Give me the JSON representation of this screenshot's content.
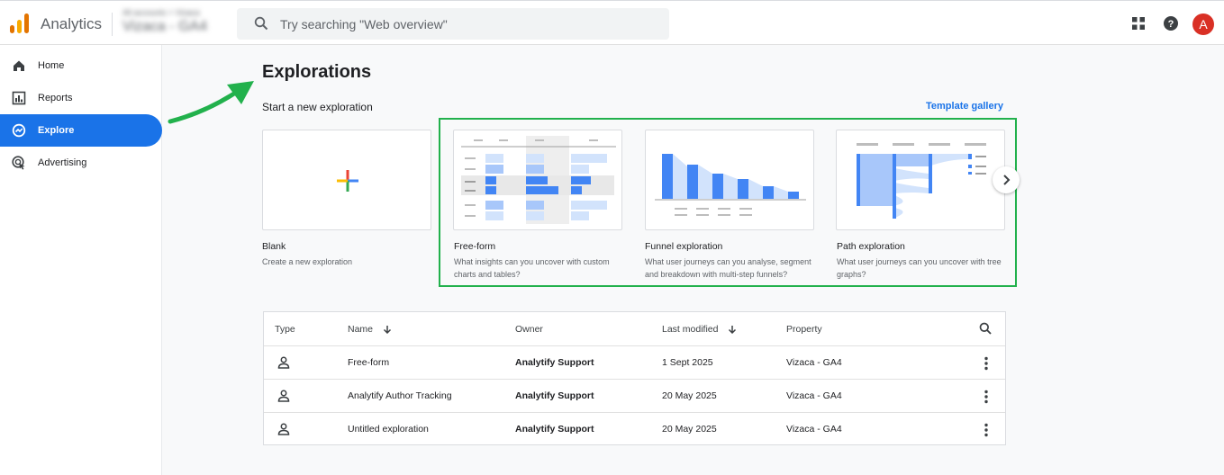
{
  "header": {
    "app_name": "Analytics",
    "account_crumb": "All accounts > Vizaca",
    "property_name": "Vizaca - GA4",
    "search_placeholder": "Try searching \"Web overview\"",
    "avatar_letter": "A",
    "icons": [
      "apps-grid-icon",
      "help-icon"
    ]
  },
  "sidebar": {
    "items": [
      {
        "label": "Home",
        "icon": "home-icon",
        "active": false
      },
      {
        "label": "Reports",
        "icon": "reports-icon",
        "active": false
      },
      {
        "label": "Explore",
        "icon": "explore-icon",
        "active": true
      },
      {
        "label": "Advertising",
        "icon": "advertising-icon",
        "active": false
      }
    ]
  },
  "main": {
    "title": "Explorations",
    "section_title": "Start a new exploration",
    "template_link": "Template gallery",
    "templates": [
      {
        "title": "Blank",
        "desc": "Create a new exploration"
      },
      {
        "title": "Free-form",
        "desc": "What insights can you uncover with custom charts and tables?"
      },
      {
        "title": "Funnel exploration",
        "desc": "What user journeys can you analyse, segment and breakdown with multi-step funnels?"
      },
      {
        "title": "Path exploration",
        "desc": "What user journeys can you uncover with tree graphs?"
      }
    ]
  },
  "table": {
    "headers": {
      "type": "Type",
      "name": "Name",
      "owner": "Owner",
      "last_modified": "Last modified",
      "property": "Property"
    },
    "rows": [
      {
        "name": "Free-form",
        "owner": "Analytify Support",
        "modified": "1 Sept 2025",
        "property": "Vizaca - GA4"
      },
      {
        "name": "Analytify Author Tracking",
        "owner": "Analytify Support",
        "modified": "20 May 2025",
        "property": "Vizaca - GA4"
      },
      {
        "name": "Untitled exploration",
        "owner": "Analytify Support",
        "modified": "20 May 2025",
        "property": "Vizaca - GA4"
      }
    ]
  },
  "colors": {
    "accent": "#1a73e8",
    "highlight": "#22b14c",
    "avatar": "#d93025"
  }
}
